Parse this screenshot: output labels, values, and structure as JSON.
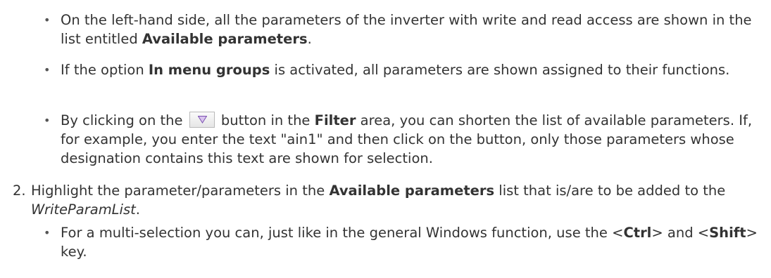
{
  "bullet1": {
    "symbol": "•",
    "t1": "On the left-hand side, all the parameters of the inverter with write and read access are shown in the list entitled ",
    "b1": "Available parameters",
    "t2": "."
  },
  "bullet2": {
    "symbol": "•",
    "t1": "If the option ",
    "b1": "In menu groups",
    "t2": " is activated, all parameters are shown assigned to their functions."
  },
  "bullet3": {
    "symbol": "•",
    "t1": "By clicking on the ",
    "button_icon": "filter-icon",
    "t2": " button in the ",
    "b1": "Filter",
    "t3": " area, you can shorten the list of available parameters. If, for example, you enter the text \"ain1\" and then click on the button, only those parameters whose designation contains this text are shown for selection."
  },
  "step2": {
    "number": "2.",
    "t1": "Highlight the parameter/parameters in the ",
    "b1": "Available parameters",
    "t2": " list that is/are to be added to the ",
    "i1": "WriteParamList",
    "t3": "."
  },
  "bullet4": {
    "symbol": "•",
    "t1": "For a multi-selection you can, just like in the general Windows function, use the <",
    "b1": "Ctrl",
    "t2": "> and <",
    "b2": "Shift",
    "t3": "> key."
  },
  "colors": {
    "text": "#333333",
    "filter_icon_fill": "#d9c4ee",
    "filter_icon_stroke": "#7a4fb0"
  }
}
